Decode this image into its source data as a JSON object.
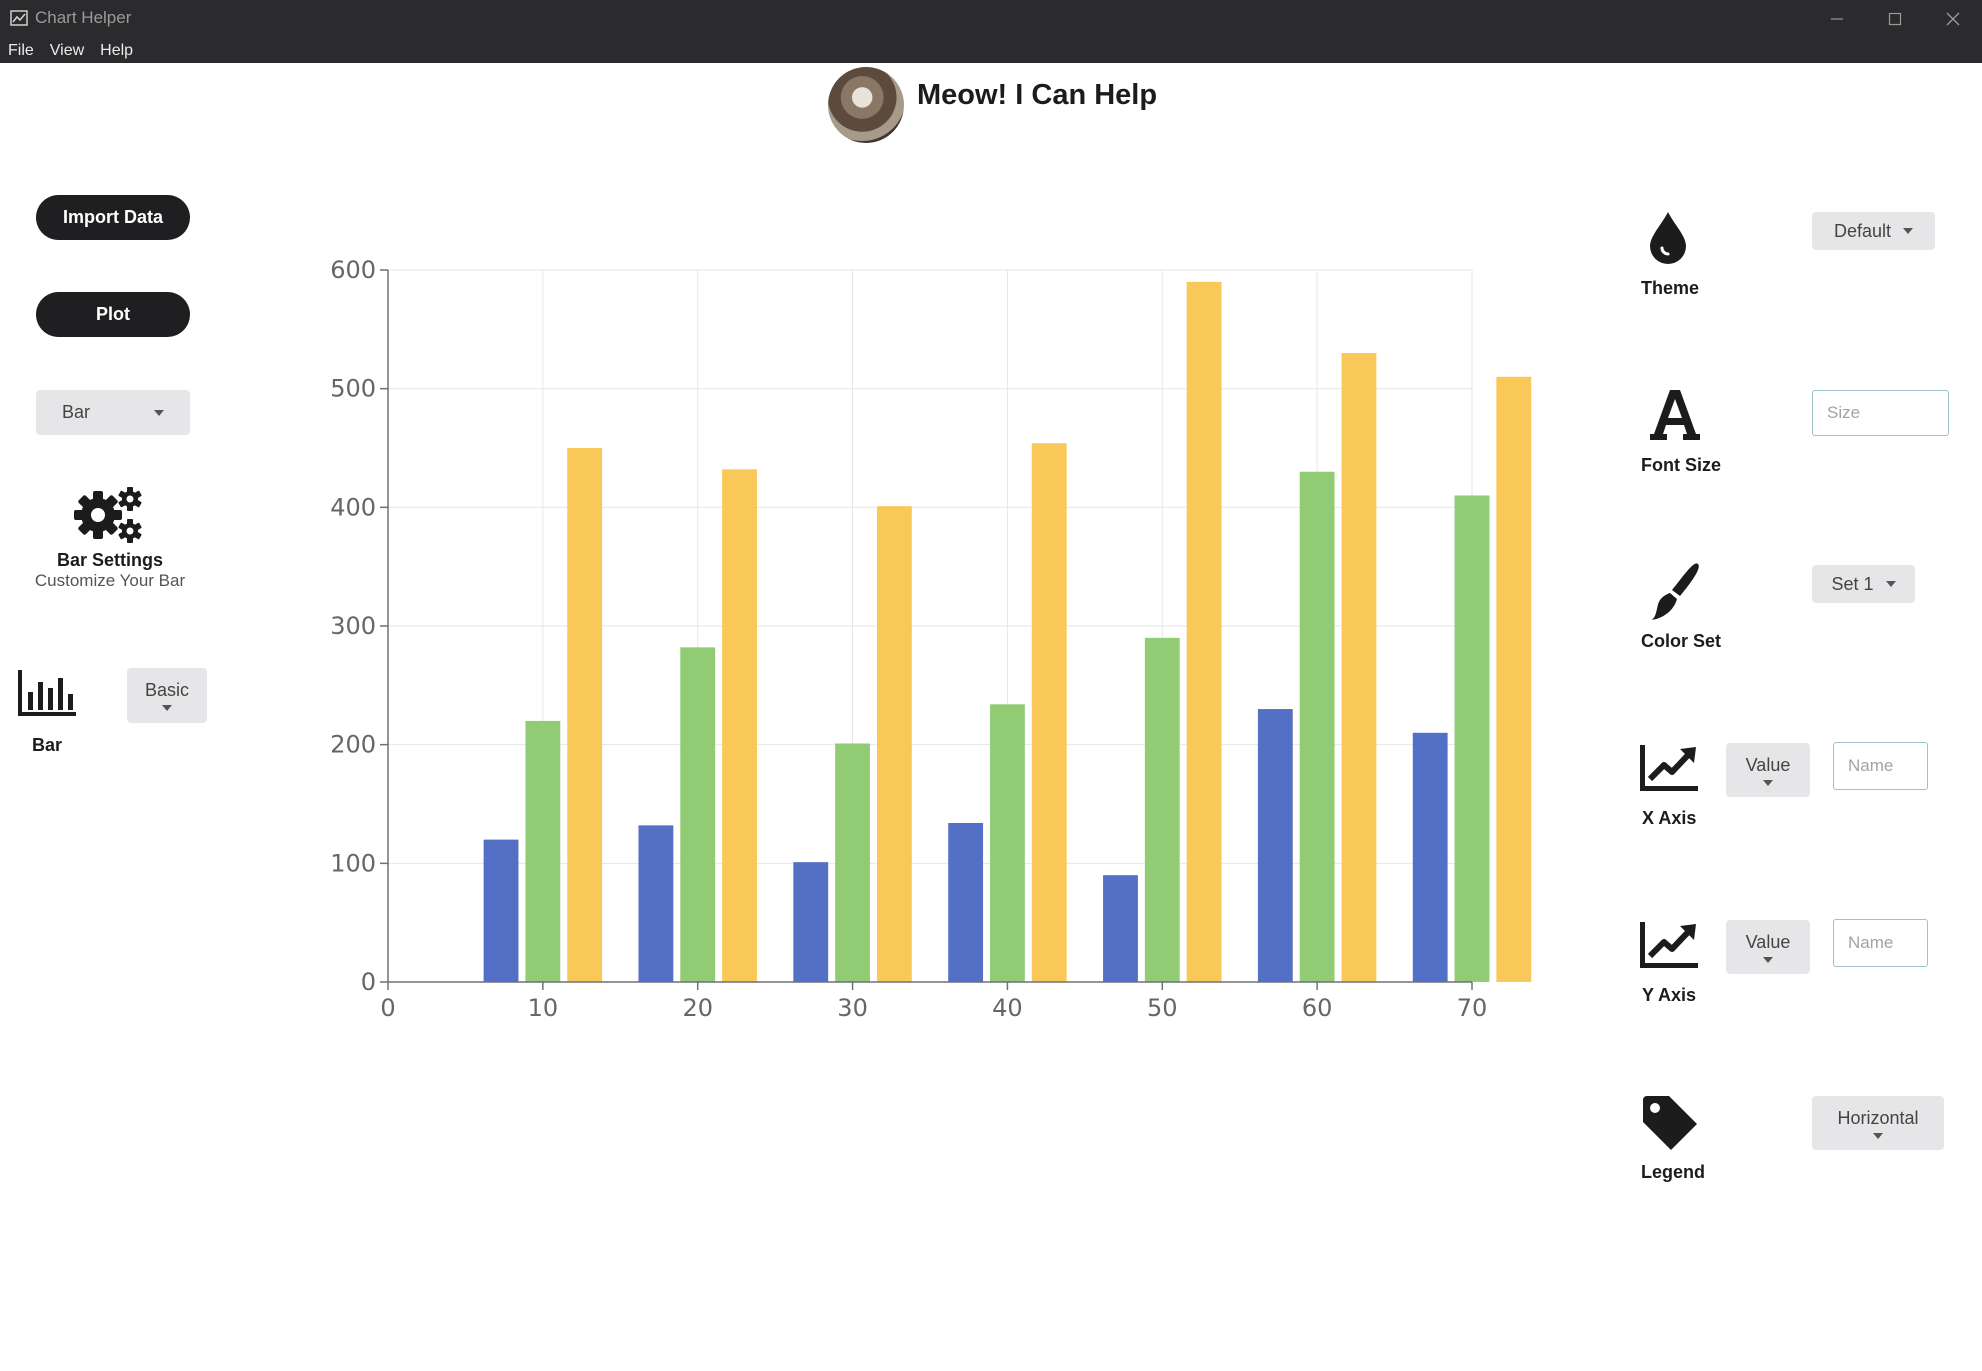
{
  "window": {
    "title": "Chart Helper",
    "menu": [
      "File",
      "View",
      "Help"
    ]
  },
  "header": {
    "title": "Meow! I Can Help"
  },
  "left_panel": {
    "import_label": "Import Data",
    "plot_label": "Plot",
    "chart_type": "Bar",
    "settings_title": "Bar Settings",
    "settings_subtitle": "Customize Your Bar",
    "bar_style_label": "Bar",
    "bar_style_select": "Basic"
  },
  "right_panel": {
    "theme": {
      "label": "Theme",
      "value": "Default"
    },
    "font_size": {
      "label": "Font Size",
      "placeholder": "Size"
    },
    "color_set": {
      "label": "Color Set",
      "value": "Set 1"
    },
    "x_axis": {
      "label": "X Axis",
      "type": "Value",
      "name_placeholder": "Name"
    },
    "y_axis": {
      "label": "Y Axis",
      "type": "Value",
      "name_placeholder": "Name"
    },
    "legend": {
      "label": "Legend",
      "value": "Horizontal"
    }
  },
  "colors": {
    "series_blue": "#5470c6",
    "series_green": "#91cc75",
    "series_yellow": "#fac858",
    "title_bar": "#2b2b2e",
    "button_dark": "#1f1f22"
  },
  "chart_data": {
    "type": "bar",
    "x_ticks": [
      "0",
      "10",
      "20",
      "30",
      "40",
      "50",
      "60",
      "70"
    ],
    "y_ticks": [
      "0",
      "100",
      "200",
      "300",
      "400",
      "500",
      "600"
    ],
    "x": [
      10,
      20,
      30,
      40,
      50,
      60,
      70
    ],
    "xlim": [
      0,
      70
    ],
    "ylim": [
      0,
      600
    ],
    "grid": true,
    "series": [
      {
        "values": [
          120,
          132,
          101,
          134,
          90,
          230,
          210
        ],
        "color": "#5470c6"
      },
      {
        "values": [
          220,
          282,
          201,
          234,
          290,
          430,
          410
        ],
        "color": "#91cc75"
      },
      {
        "values": [
          450,
          432,
          401,
          454,
          590,
          530,
          510
        ],
        "color": "#fac858"
      }
    ]
  }
}
